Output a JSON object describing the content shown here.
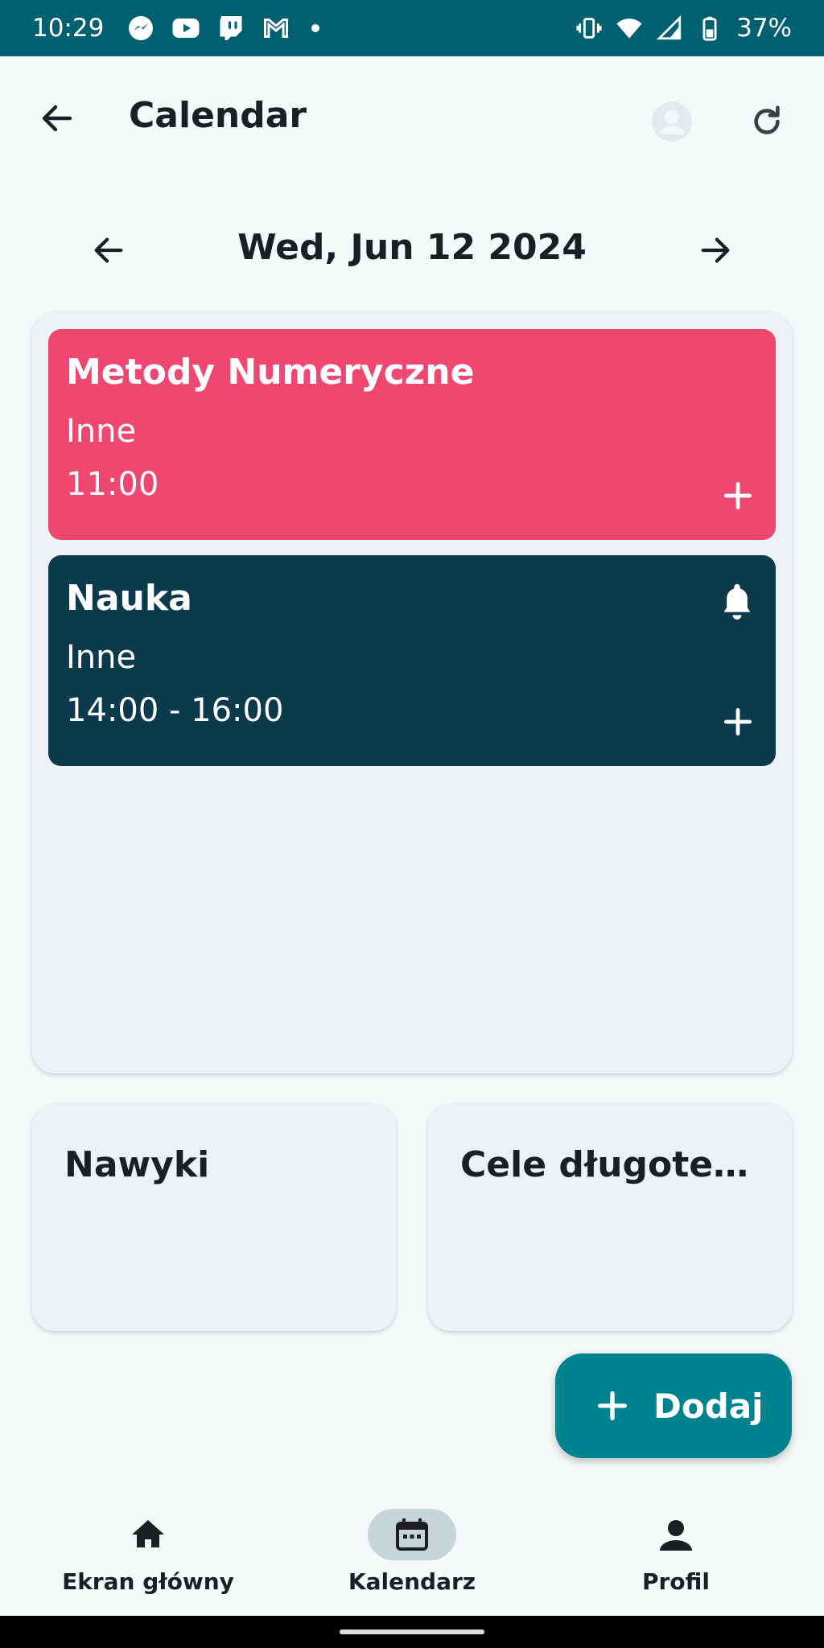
{
  "status_bar": {
    "time": "10:29",
    "battery": "37%",
    "notification_icons": [
      "messenger-icon",
      "youtube-icon",
      "twitch-icon",
      "gmail-icon"
    ]
  },
  "app_bar": {
    "title": "Calendar"
  },
  "date_nav": {
    "date": "Wed, Jun 12 2024"
  },
  "events": [
    {
      "title": "Metody Numeryczne",
      "category": "Inne",
      "time": "11:00",
      "color": "#ef4770",
      "has_reminder": false
    },
    {
      "title": "Nauka",
      "category": "Inne",
      "time": "14:00 - 16:00",
      "color": "#0b3a4c",
      "has_reminder": true
    }
  ],
  "cards": {
    "habits_title": "Nawyki",
    "goals_title": "Cele długote…"
  },
  "fab": {
    "label": "Dodaj",
    "color": "#00838f"
  },
  "bottom_nav": {
    "items": [
      {
        "label": "Ekran główny",
        "icon": "home-icon",
        "active": false
      },
      {
        "label": "Kalendarz",
        "icon": "calendar-icon",
        "active": true
      },
      {
        "label": "Profil",
        "icon": "person-icon",
        "active": false
      }
    ]
  },
  "theme": {
    "status_bar_color": "#00606f",
    "background": "#f5f9fa",
    "card_background": "#eef2f5",
    "active_nav_indicator": "#c7d5d9"
  }
}
